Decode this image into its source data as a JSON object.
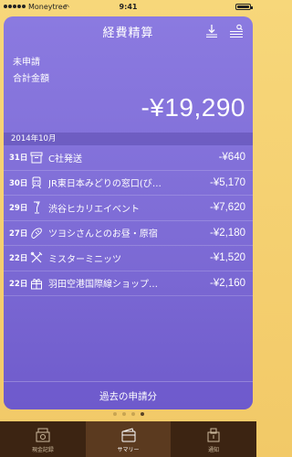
{
  "status_bar": {
    "carrier": "Moneytree",
    "time": "9:41"
  },
  "header": {
    "title": "経費精算"
  },
  "summary": {
    "status_label": "未申請",
    "total_label": "合計金額",
    "total_amount": "-¥19,290"
  },
  "month_header": "2014年10月",
  "expenses": [
    {
      "day": "31日",
      "icon": "box-icon",
      "name": "C社発送",
      "amount": "-¥640"
    },
    {
      "day": "30日",
      "icon": "train-icon",
      "name": "JR東日本みどりの窓口(びゅうプ...",
      "amount": "-¥5,170"
    },
    {
      "day": "29日",
      "icon": "drink-icon",
      "name": "渋谷ヒカリエイベント",
      "amount": "-¥7,620"
    },
    {
      "day": "27日",
      "icon": "bread-icon",
      "name": "ツヨシさんとのお昼・原宿",
      "amount": "-¥2,180"
    },
    {
      "day": "22日",
      "icon": "utensils-icon",
      "name": "ミスターミニッツ",
      "amount": "-¥1,520"
    },
    {
      "day": "22日",
      "icon": "gift-icon",
      "name": "羽田空港国際線ショップアンド...",
      "amount": "-¥2,160"
    }
  ],
  "past_requests_label": "過去の申請分",
  "page_dots": {
    "count": 4,
    "active_index": 3
  },
  "tabs": [
    {
      "label": "現金記録",
      "icon": "cash-register-icon",
      "active": false
    },
    {
      "label": "サマリー",
      "icon": "wallet-icon",
      "active": true
    },
    {
      "label": "通知",
      "icon": "notification-icon",
      "active": false
    }
  ]
}
